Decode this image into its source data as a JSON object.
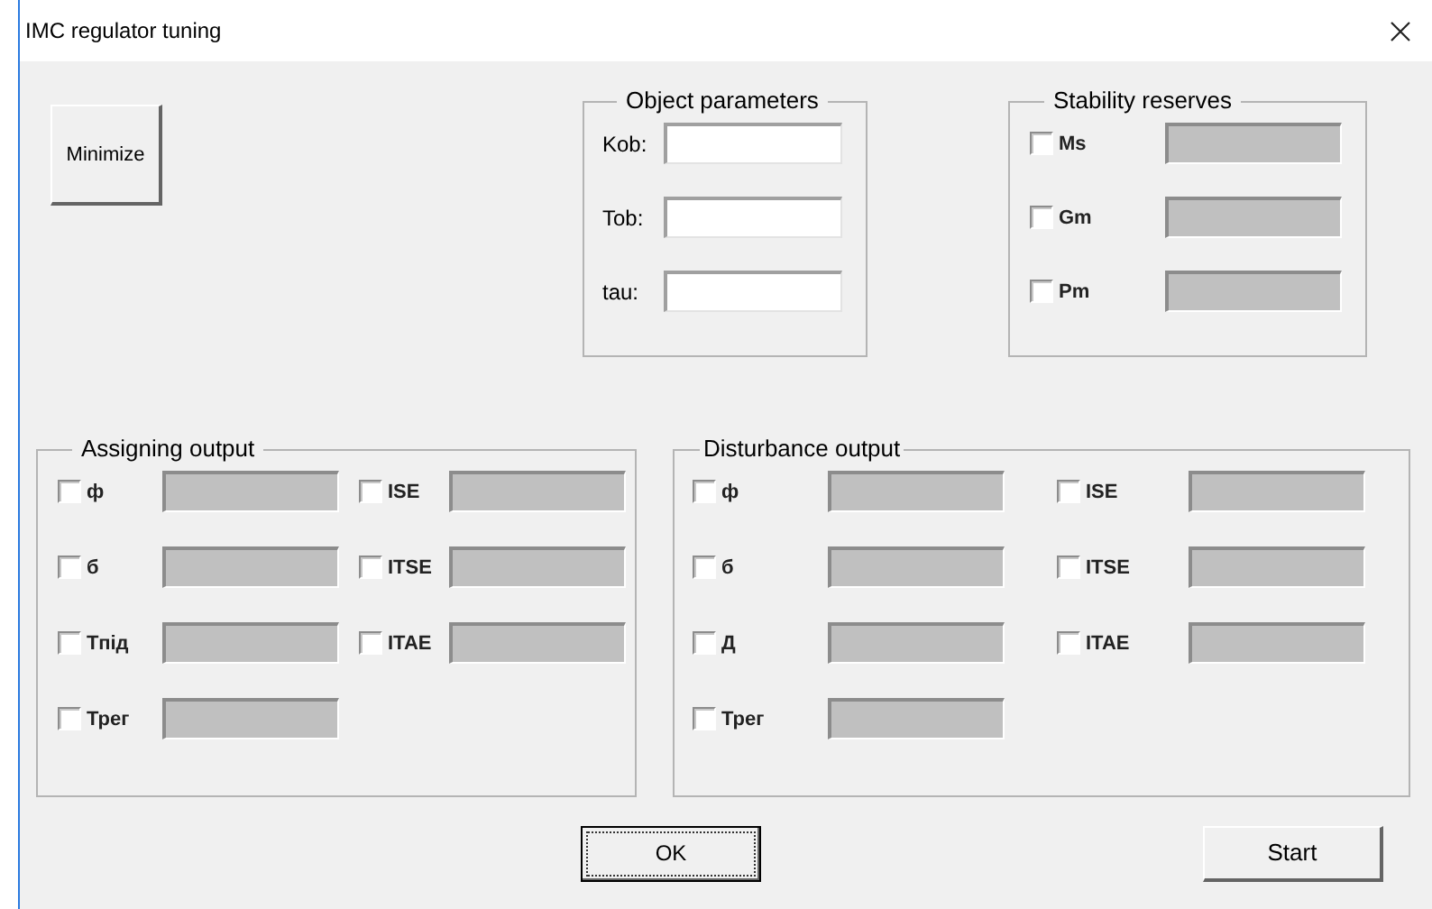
{
  "window": {
    "title": "IMC regulator tuning"
  },
  "minimize_button": {
    "label": "Minimize"
  },
  "object_parameters": {
    "title": "Object parameters",
    "fields": [
      {
        "label": "Kob:"
      },
      {
        "label": "Tob:"
      },
      {
        "label": "tau:"
      }
    ]
  },
  "stability_reserves": {
    "title": "Stability reserves",
    "items": [
      {
        "label": "Ms",
        "checked": false
      },
      {
        "label": "Gm",
        "checked": false
      },
      {
        "label": "Pm",
        "checked": false
      }
    ]
  },
  "assigning_output": {
    "title": "Assigning output",
    "items": [
      {
        "label": "ф",
        "checked": false
      },
      {
        "label": "ISE",
        "checked": false
      },
      {
        "label": "б",
        "checked": false
      },
      {
        "label": "ITSE",
        "checked": false
      },
      {
        "label": "Тпід",
        "checked": false
      },
      {
        "label": "ITAE",
        "checked": false
      },
      {
        "label": "Трег",
        "checked": false
      }
    ]
  },
  "disturbance_output": {
    "title": "Disturbance output",
    "items": [
      {
        "label": "ф",
        "checked": false
      },
      {
        "label": "ISE",
        "checked": false
      },
      {
        "label": "б",
        "checked": false
      },
      {
        "label": "ITSE",
        "checked": false
      },
      {
        "label": "Д",
        "checked": false
      },
      {
        "label": "ITAE",
        "checked": false
      },
      {
        "label": "Трег",
        "checked": false
      }
    ]
  },
  "buttons": [
    {
      "label": "OK",
      "focused": true
    },
    {
      "label": "Start",
      "focused": false
    }
  ]
}
